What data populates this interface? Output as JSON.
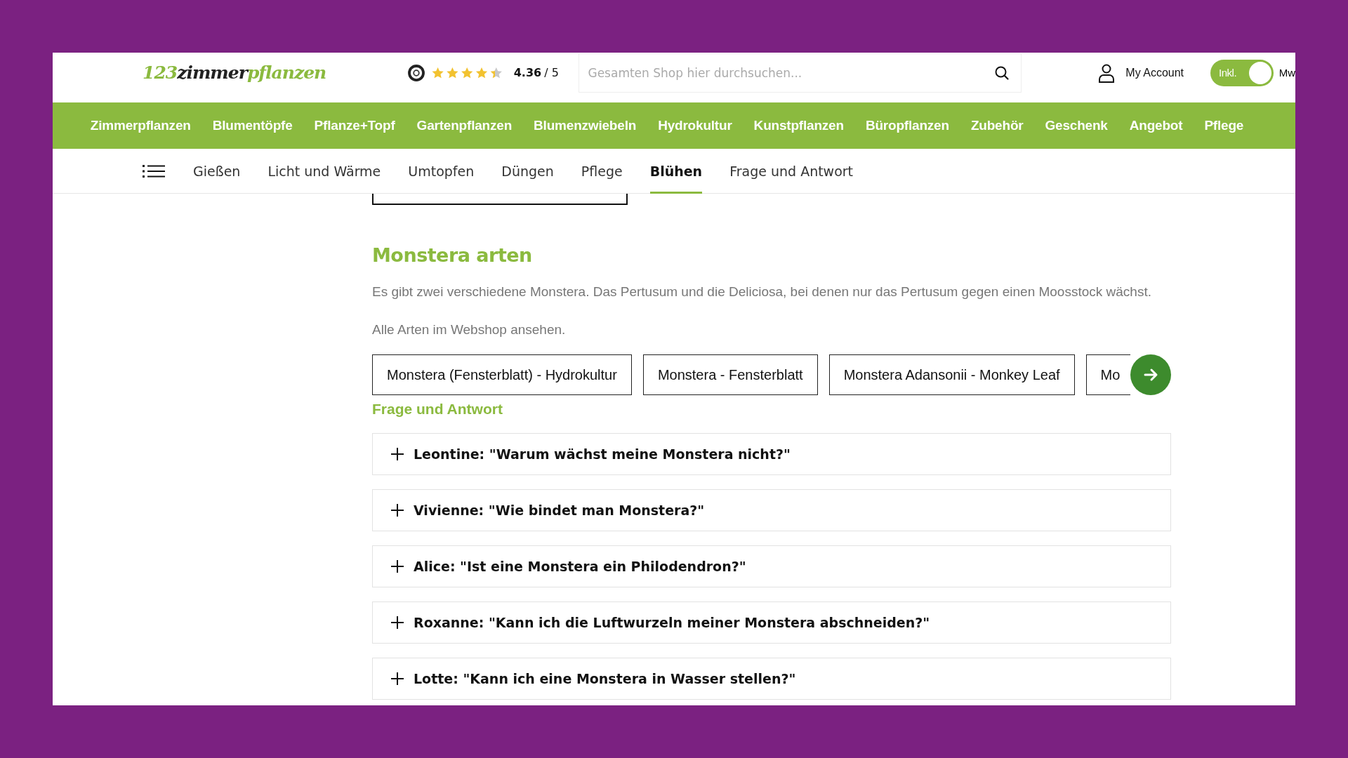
{
  "header": {
    "logo": {
      "part_1": "123",
      "part_2": "zimmer",
      "part_3": "pflanzen"
    },
    "rating": {
      "stars": 4.36,
      "score": "4.36",
      "scale": "/ 5"
    },
    "search": {
      "placeholder": "Gesamten Shop hier durchsuchen..."
    },
    "account": "My Account",
    "vat_toggle": {
      "label": "Inkl.",
      "on": true,
      "trailing": "Mw"
    }
  },
  "main_nav": [
    "Zimmerpflanzen",
    "Blumentöpfe",
    "Pflanze+Topf",
    "Gartenpflanzen",
    "Blumenzwiebeln",
    "Hydrokultur",
    "Kunstpflanzen",
    "Büropflanzen",
    "Zubehör",
    "Geschenk",
    "Angebot",
    "Pflege"
  ],
  "sub_nav": [
    {
      "label": "Gießen",
      "selected": false
    },
    {
      "label": "Licht und Wärme",
      "selected": false
    },
    {
      "label": "Umtopfen",
      "selected": false
    },
    {
      "label": "Düngen",
      "selected": false
    },
    {
      "label": "Pflege",
      "selected": false
    },
    {
      "label": "Blühen",
      "selected": true
    },
    {
      "label": "Frage und Antwort",
      "selected": false
    }
  ],
  "section": {
    "title": "Monstera arten",
    "text": "Es gibt zwei verschiedene Monstera. Das Pertusum und die Deliciosa, bei denen nur das Pertusum gegen einen Moosstock wächst.",
    "link_text": "Alle Arten im Webshop ansehen.",
    "products": [
      "Monstera (Fensterblatt) - Hydrokultur",
      "Monstera - Fensterblatt",
      "Monstera Adansonii - Monkey Leaf",
      "Mo"
    ]
  },
  "faq": {
    "title": "Frage und Antwort",
    "items": [
      {
        "question": "Leontine: \"Warum wächst meine Monstera nicht?\"",
        "expanded": false
      },
      {
        "question": "Vivienne: \"Wie bindet man Monstera?\"",
        "expanded": false
      },
      {
        "question": "Alice: \"Ist eine Monstera ein Philodendron?\"",
        "expanded": false
      },
      {
        "question": "Roxanne: \"Kann ich die Luftwurzeln meiner Monstera abschneiden?\"",
        "expanded": false
      },
      {
        "question": "Lotte: \"Kann ich eine Monstera in Wasser stellen?\"",
        "expanded": false
      }
    ]
  }
}
